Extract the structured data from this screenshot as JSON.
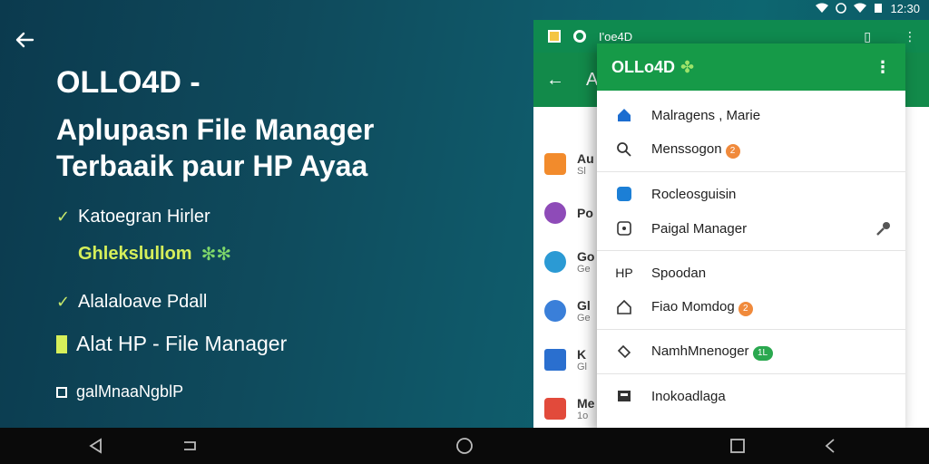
{
  "status_bar": {
    "time": "12:30"
  },
  "headline": {
    "line1": "OLLO4D -",
    "line2a": "Aplupasn File Manager",
    "line2b": "Terbaaik paur HP Ayaa"
  },
  "features": [
    {
      "text": "Katoegran Hirler"
    },
    {
      "text": "Ghlekslullom"
    },
    {
      "text": "Alalaloave Pdall"
    },
    {
      "text": "Alat HP - File Manager"
    },
    {
      "text": "galMnaaNgblP"
    }
  ],
  "phone": {
    "top_title": "I'oe4D",
    "appbar_letter": "A",
    "rows": [
      {
        "title": "Au",
        "sub": "Sl"
      },
      {
        "title": "Po",
        "sub": ""
      },
      {
        "title": "Go",
        "sub": "Ge"
      },
      {
        "title": "Gl",
        "sub": "Ge"
      },
      {
        "title": "K",
        "sub": "Gl"
      },
      {
        "title": "Me",
        "sub": "1o"
      }
    ]
  },
  "menu": {
    "title": "OLLo4D",
    "items": [
      {
        "label": "Malragens , Marie",
        "badge": ""
      },
      {
        "label": "Menssogon",
        "badge": "2"
      },
      {
        "label": "Rocleosguisin",
        "badge": ""
      },
      {
        "label": "Paigal Manager",
        "badge": ""
      },
      {
        "label": "Spoodan",
        "badge": "",
        "prefix": "HP"
      },
      {
        "label": "Fiao Momdog",
        "badge": "2"
      },
      {
        "label": "NamhMnenoger",
        "badge": "1L"
      },
      {
        "label": "Inokoadlaga",
        "badge": ""
      }
    ]
  },
  "colors": {
    "accent_green": "#169a48",
    "highlight_lime": "#d6ef5a",
    "badge_orange": "#f08a3c"
  }
}
